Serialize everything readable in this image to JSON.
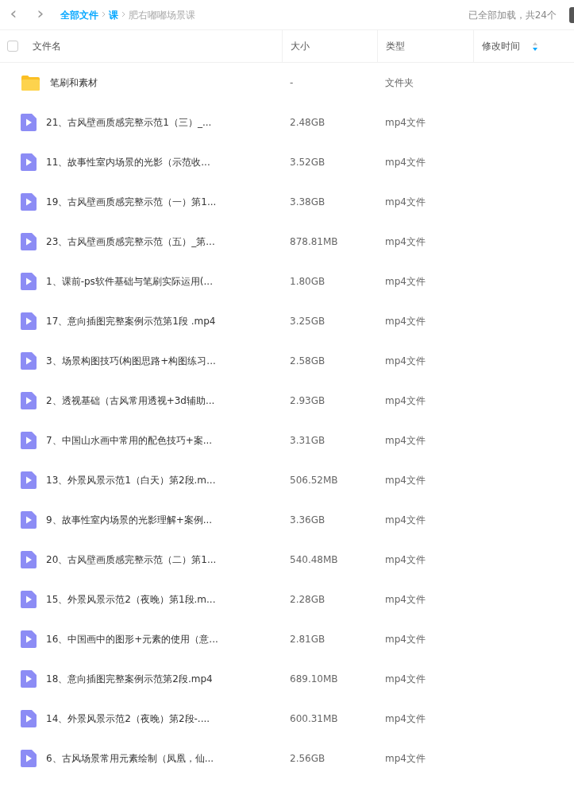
{
  "nav": {
    "back": "‹",
    "forward": "›"
  },
  "breadcrumb": [
    {
      "label": "全部文件",
      "current": false
    },
    {
      "label": "课",
      "current": false
    },
    {
      "label": "肥右嘟嘟场景课",
      "current": true
    }
  ],
  "load_status": "已全部加载，共24个",
  "table": {
    "selected_all": false,
    "columns": [
      {
        "label": "文件名",
        "kind": "plain"
      },
      {
        "label": "大小",
        "kind": "plain"
      },
      {
        "label": "类型",
        "kind": "plain"
      },
      {
        "label": "修改时间",
        "kind": "sorted"
      }
    ],
    "rows": [
      {
        "kind": "folder",
        "name": "笔刷和素材",
        "size": "-",
        "type": "文件夹"
      },
      {
        "kind": "video",
        "name": "21、古风壁画质感完整示范1（三）_...",
        "size": "2.48GB",
        "type": "mp4文件"
      },
      {
        "kind": "video",
        "name": "11、故事性室内场景的光影（示范收...",
        "size": "3.52GB",
        "type": "mp4文件"
      },
      {
        "kind": "video",
        "name": "19、古风壁画质感完整示范（一）第1...",
        "size": "3.38GB",
        "type": "mp4文件"
      },
      {
        "kind": "video",
        "name": "23、古风壁画质感完整示范（五）_第...",
        "size": "878.81MB",
        "type": "mp4文件"
      },
      {
        "kind": "video",
        "name": "1、课前-ps软件基础与笔刷实际运用(...",
        "size": "1.80GB",
        "type": "mp4文件"
      },
      {
        "kind": "video",
        "name": "17、意向插图完整案例示范第1段 .mp4",
        "size": "3.25GB",
        "type": "mp4文件"
      },
      {
        "kind": "video",
        "name": "3、场景构图技巧(构图思路+构图练习...",
        "size": "2.58GB",
        "type": "mp4文件"
      },
      {
        "kind": "video",
        "name": "2、透视基础（古风常用透视+3d辅助...",
        "size": "2.93GB",
        "type": "mp4文件"
      },
      {
        "kind": "video",
        "name": "7、中国山水画中常用的配色技巧+案...",
        "size": "3.31GB",
        "type": "mp4文件"
      },
      {
        "kind": "video",
        "name": "13、外景风景示范1（白天）第2段.m...",
        "size": "506.52MB",
        "type": "mp4文件"
      },
      {
        "kind": "video",
        "name": "9、故事性室内场景的光影理解+案例...",
        "size": "3.36GB",
        "type": "mp4文件"
      },
      {
        "kind": "video",
        "name": "20、古风壁画质感完整示范（二）第1...",
        "size": "540.48MB",
        "type": "mp4文件"
      },
      {
        "kind": "video",
        "name": "15、外景风景示范2（夜晚）第1段.m...",
        "size": "2.28GB",
        "type": "mp4文件"
      },
      {
        "kind": "video",
        "name": "16、中国画中的图形+元素的使用（意...",
        "size": "2.81GB",
        "type": "mp4文件"
      },
      {
        "kind": "video",
        "name": "18、意向插图完整案例示范第2段.mp4",
        "size": "689.10MB",
        "type": "mp4文件"
      },
      {
        "kind": "video",
        "name": "14、外景风景示范2（夜晚）第2段-....",
        "size": "600.31MB",
        "type": "mp4文件"
      },
      {
        "kind": "video",
        "name": "6、古风场景常用元素绘制（凤凰，仙...",
        "size": "2.56GB",
        "type": "mp4文件"
      }
    ]
  }
}
